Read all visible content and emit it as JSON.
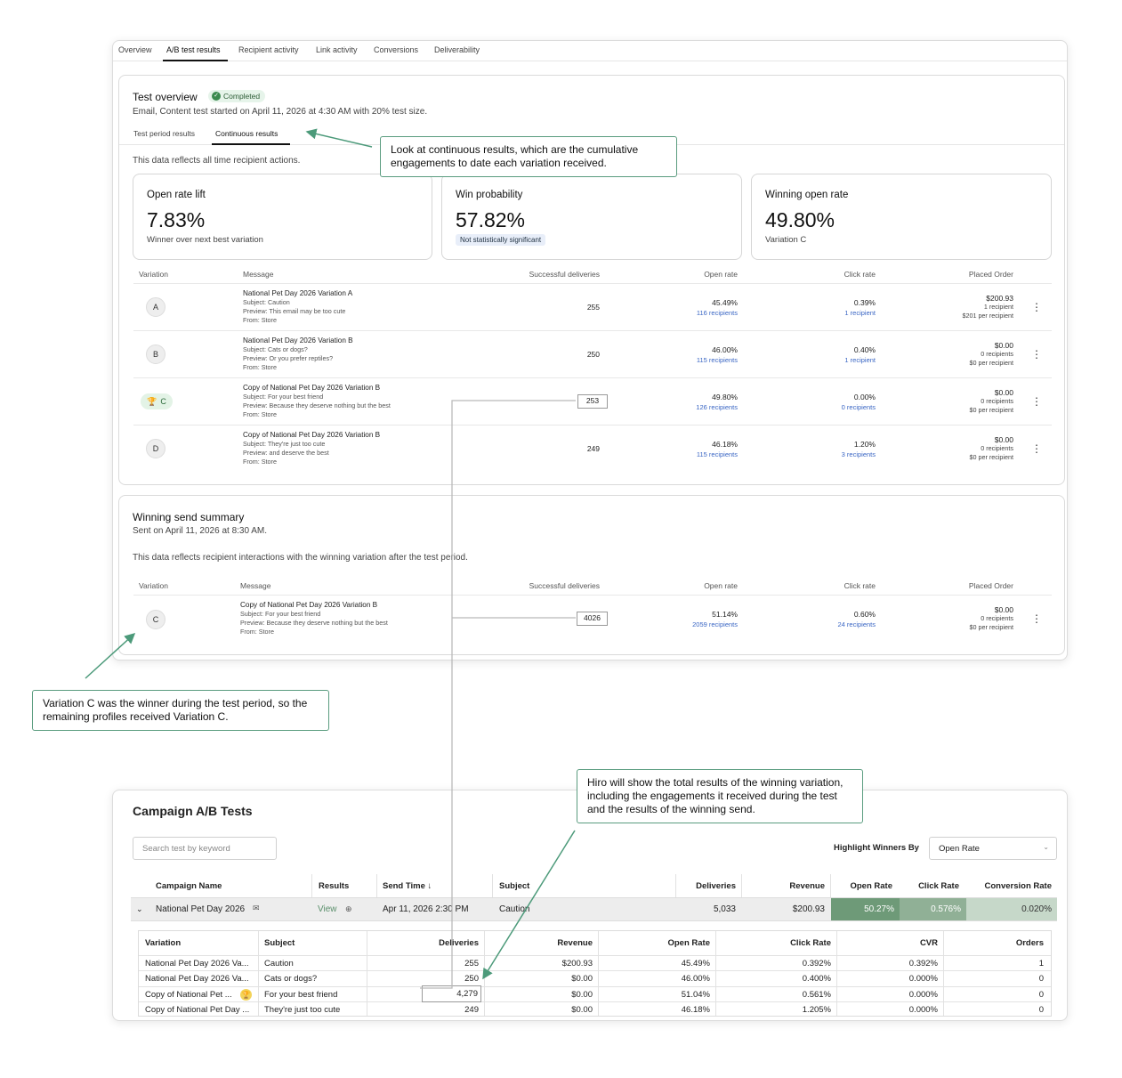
{
  "tabs": [
    "Overview",
    "A/B test results",
    "Recipient activity",
    "Link activity",
    "Conversions",
    "Deliverability"
  ],
  "test_overview": {
    "title": "Test overview",
    "status": "Completed",
    "description": "Email, Content test started on April 11, 2026 at 4:30 AM with 20% test size.",
    "subtabs": [
      "Test period results",
      "Continuous results"
    ],
    "note": "This data reflects all time recipient actions.",
    "metrics": [
      {
        "title": "Open rate lift",
        "value": "7.83%",
        "footer": "Winner over next best variation"
      },
      {
        "title": "Win probability",
        "value": "57.82%",
        "footer": "Not statistically significant"
      },
      {
        "title": "Winning open rate",
        "value": "49.80%",
        "footer": "Variation C"
      }
    ],
    "headers": {
      "variation": "Variation",
      "message": "Message",
      "deliveries": "Successful deliveries",
      "open_rate": "Open rate",
      "click_rate": "Click rate",
      "placed_order": "Placed Order"
    },
    "rows": [
      {
        "variation": "A",
        "name": "National Pet Day 2026 Variation A",
        "subject": "Subject: Caution",
        "preview": "Preview: This email may be too cute",
        "from": "From: Store",
        "deliveries": "255",
        "open_rate": "45.49%",
        "open_recipients": "116 recipients",
        "click_rate": "0.39%",
        "click_recipients": "1 recipient",
        "order_value": "$200.93",
        "order_recipients": "1 recipient",
        "order_per": "$201 per recipient"
      },
      {
        "variation": "B",
        "name": "National Pet Day 2026 Variation B",
        "subject": "Subject: Cats or dogs?",
        "preview": "Preview: Or you prefer reptiles?",
        "from": "From: Store",
        "deliveries": "250",
        "open_rate": "46.00%",
        "open_recipients": "115 recipients",
        "click_rate": "0.40%",
        "click_recipients": "1 recipient",
        "order_value": "$0.00",
        "order_recipients": "0 recipients",
        "order_per": "$0 per recipient"
      },
      {
        "variation": "C",
        "name": "Copy of National Pet Day 2026 Variation B",
        "subject": "Subject: For your best friend",
        "preview": "Preview: Because they deserve nothing but the best",
        "from": "From: Store",
        "deliveries": "253",
        "open_rate": "49.80%",
        "open_recipients": "126 recipients",
        "click_rate": "0.00%",
        "click_recipients": "0 recipients",
        "order_value": "$0.00",
        "order_recipients": "0 recipients",
        "order_per": "$0 per recipient"
      },
      {
        "variation": "D",
        "name": "Copy of National Pet Day 2026 Variation B",
        "subject": "Subject: They're just too cute",
        "preview": "Preview: and deserve the best",
        "from": "From: Store",
        "deliveries": "249",
        "open_rate": "46.18%",
        "open_recipients": "115 recipients",
        "click_rate": "1.20%",
        "click_recipients": "3 recipients",
        "order_value": "$0.00",
        "order_recipients": "0 recipients",
        "order_per": "$0 per recipient"
      }
    ]
  },
  "winning_send": {
    "title": "Winning send summary",
    "sent": "Sent on April 11, 2026 at 8:30 AM.",
    "note": "This data reflects recipient interactions with the winning variation after the test period.",
    "row": {
      "variation": "C",
      "name": "Copy of National Pet Day 2026 Variation B",
      "subject": "Subject: For your best friend",
      "preview": "Preview: Because they deserve nothing but the best",
      "from": "From: Store",
      "deliveries": "4026",
      "open_rate": "51.14%",
      "open_recipients": "2059 recipients",
      "click_rate": "0.60%",
      "click_recipients": "24 recipients",
      "order_value": "$0.00",
      "order_recipients": "0 recipients",
      "order_per": "$0 per recipient"
    }
  },
  "callouts": {
    "continuous": "Look at continuous results, which are the cumulative engagements to date each variation received.",
    "winner": "Variation C was the winner during the test period, so the remaining profiles received Variation C.",
    "hiro": "Hiro will show the total results of the winning variation, including the engagements it received during the test and the results of the winning send."
  },
  "campaign": {
    "title": "Campaign A/B Tests",
    "search_placeholder": "Search test by keyword",
    "highlight_label": "Highlight Winners By",
    "highlight_value": "Open Rate",
    "headers": {
      "name": "Campaign Name",
      "results": "Results",
      "send_time": "Send Time",
      "subject": "Subject",
      "deliveries": "Deliveries",
      "revenue": "Revenue",
      "open_rate": "Open Rate",
      "click_rate": "Click Rate",
      "conversion_rate": "Conversion Rate"
    },
    "row": {
      "name": "National Pet Day 2026",
      "results": "View",
      "send_time": "Apr 11, 2026 2:30 PM",
      "subject": "Caution",
      "deliveries": "5,033",
      "revenue": "$200.93",
      "open_rate": "50.27%",
      "click_rate": "0.576%",
      "conversion_rate": "0.020%"
    },
    "heat_colors": {
      "open_rate": "#6e9a78",
      "click_rate": "#90b096",
      "conversion_rate": "#c6d8c9"
    },
    "variants_headers": {
      "variation": "Variation",
      "subject": "Subject",
      "deliveries": "Deliveries",
      "revenue": "Revenue",
      "open_rate": "Open Rate",
      "click_rate": "Click Rate",
      "cvr": "CVR",
      "orders": "Orders"
    },
    "variants": [
      {
        "variation": "National Pet Day 2026 Va...",
        "subject": "Caution",
        "deliveries": "255",
        "revenue": "$200.93",
        "open_rate": "45.49%",
        "click_rate": "0.392%",
        "cvr": "0.392%",
        "orders": "1"
      },
      {
        "variation": "National Pet Day 2026 Va...",
        "subject": "Cats or dogs?",
        "deliveries": "250",
        "revenue": "$0.00",
        "open_rate": "46.00%",
        "click_rate": "0.400%",
        "cvr": "0.000%",
        "orders": "0"
      },
      {
        "variation": "Copy of National Pet ...",
        "subject": "For your best friend",
        "deliveries": "4,279",
        "revenue": "$0.00",
        "open_rate": "51.04%",
        "click_rate": "0.561%",
        "cvr": "0.000%",
        "orders": "0"
      },
      {
        "variation": "Copy of National Pet Day ...",
        "subject": "They're just too cute",
        "deliveries": "249",
        "revenue": "$0.00",
        "open_rate": "46.18%",
        "click_rate": "1.205%",
        "cvr": "0.000%",
        "orders": "0"
      }
    ]
  }
}
